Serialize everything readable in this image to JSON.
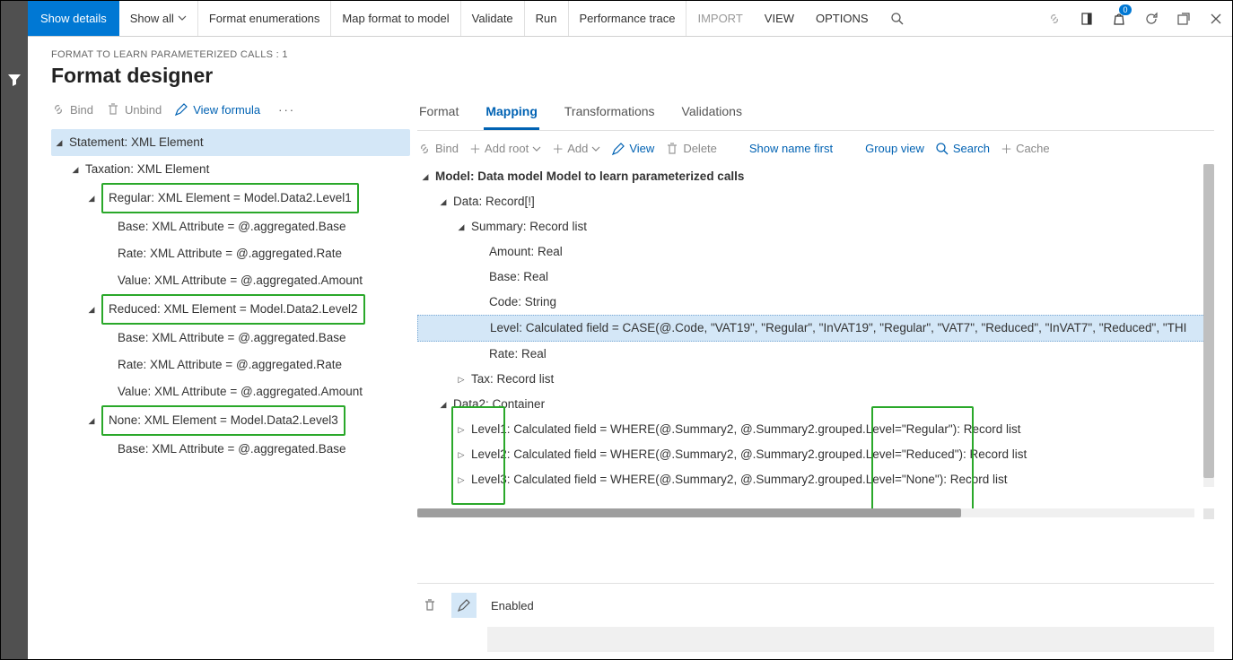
{
  "toolbar": {
    "show_details": "Show details",
    "show_all": "Show all",
    "format_enum": "Format enumerations",
    "map_model": "Map format to model",
    "validate": "Validate",
    "run": "Run",
    "perf_trace": "Performance trace",
    "import": "IMPORT",
    "view": "VIEW",
    "options": "OPTIONS",
    "badge_count": "0"
  },
  "breadcrumb": "FORMAT TO LEARN PARAMETERIZED CALLS : 1",
  "page_title": "Format designer",
  "tree_actions": {
    "bind": "Bind",
    "unbind": "Unbind",
    "view_formula": "View formula"
  },
  "tree": {
    "root": "Statement: XML Element",
    "tax": "Taxation: XML Element",
    "regular": "Regular: XML Element = Model.Data2.Level1",
    "reg_base": "Base: XML Attribute = @.aggregated.Base",
    "reg_rate": "Rate: XML Attribute = @.aggregated.Rate",
    "reg_value": "Value: XML Attribute = @.aggregated.Amount",
    "reduced": "Reduced: XML Element = Model.Data2.Level2",
    "red_base": "Base: XML Attribute = @.aggregated.Base",
    "red_rate": "Rate: XML Attribute = @.aggregated.Rate",
    "red_value": "Value: XML Attribute = @.aggregated.Amount",
    "none": "None: XML Element = Model.Data2.Level3",
    "none_base": "Base: XML Attribute = @.aggregated.Base"
  },
  "tabs": {
    "format": "Format",
    "mapping": "Mapping",
    "transformations": "Transformations",
    "validations": "Validations"
  },
  "map_actions": {
    "bind": "Bind",
    "add_root": "Add root",
    "add": "Add",
    "view": "View",
    "delete": "Delete",
    "show_name": "Show name first",
    "group_view": "Group view",
    "search": "Search",
    "cache": "Cache"
  },
  "maptree": {
    "model": "Model: Data model Model to learn parameterized calls",
    "data": "Data: Record[!]",
    "summary": "Summary: Record list",
    "amount": "Amount: Real",
    "base": "Base: Real",
    "code": "Code: String",
    "level": "Level: Calculated field = CASE(@.Code, \"VAT19\", \"Regular\", \"InVAT19\", \"Regular\", \"VAT7\", \"Reduced\", \"InVAT7\", \"Reduced\", \"THI",
    "rate": "Rate: Real",
    "tax": "Tax: Record list",
    "data2": "Data2: Container",
    "level1": "Level1: Calculated field = WHERE(@.Summary2, @.Summary2.grouped.Level=\"Regular\"): Record list",
    "level2": "Level2: Calculated field = WHERE(@.Summary2, @.Summary2.grouped.Level=\"Reduced\"): Record list",
    "level3": "Level3: Calculated field = WHERE(@.Summary2, @.Summary2.grouped.Level=\"None\"): Record list"
  },
  "footer": {
    "enabled": "Enabled"
  }
}
